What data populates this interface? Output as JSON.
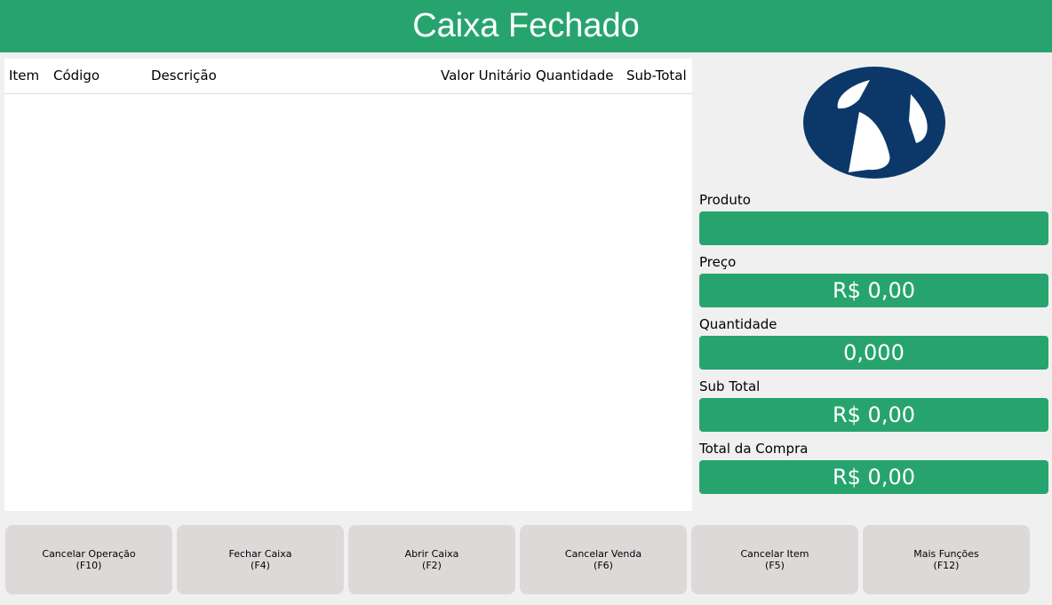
{
  "header": {
    "title": "Caixa Fechado"
  },
  "items_table": {
    "columns": [
      "Item",
      "Código",
      "Descrição",
      "Valor Unitário",
      "Quantidade",
      "Sub-Total"
    ],
    "rows": []
  },
  "fields": {
    "produto": {
      "label": "Produto",
      "value": ""
    },
    "preco": {
      "label": "Preço",
      "value": "R$ 0,00"
    },
    "quantidade": {
      "label": "Quantidade",
      "value": "0,000"
    },
    "sub_total": {
      "label": "Sub Total",
      "value": "R$ 0,00"
    },
    "total_compra": {
      "label": "Total da Compra",
      "value": "R$ 0,00"
    }
  },
  "buttons": [
    {
      "label": "Cancelar Operação",
      "shortcut": "(F10)"
    },
    {
      "label": "Fechar Caixa",
      "shortcut": "(F4)"
    },
    {
      "label": "Abrir Caixa",
      "shortcut": "(F2)"
    },
    {
      "label": "Cancelar Venda",
      "shortcut": "(F6)"
    },
    {
      "label": "Cancelar Item",
      "shortcut": "(F5)"
    },
    {
      "label": "Mais Funções",
      "shortcut": "(F12)"
    }
  ],
  "colors": {
    "accent": "#27a46e",
    "logo": "#0b3868",
    "button_bg": "#ded9d9",
    "background": "#f0f0f0"
  },
  "logo": {
    "icon": "company-logo"
  }
}
